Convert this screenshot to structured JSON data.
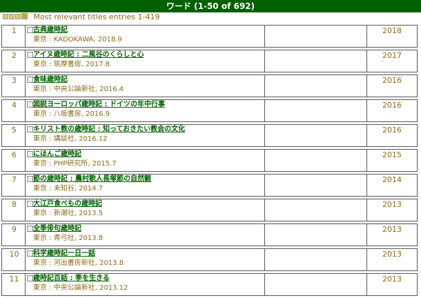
{
  "header": {
    "title": "ワード (1-50 of 692)"
  },
  "subheader": {
    "text": "Most relevant titles entries 1-419"
  },
  "entries": [
    {
      "num": "1",
      "title": "古典歳時記",
      "publisher": "東京 : KADOKAWA, 2018.9",
      "year": "2018"
    },
    {
      "num": "2",
      "title": "アイヌ歳時記 : 二風谷のくらしと心",
      "publisher": "東京 : 筑摩書房, 2017.8",
      "year": "2017"
    },
    {
      "num": "3",
      "title": "食味歳時記",
      "publisher": "東京 : 中央公論新社, 2016.4",
      "year": "2016"
    },
    {
      "num": "4",
      "title": "図説ヨーロッパ歳時記 : ドイツの年中行事",
      "publisher": "東京 : 八坂書房, 2016.9",
      "year": "2016"
    },
    {
      "num": "5",
      "title": "キリスト教の歳時記 : 知っておきたい教会の文化",
      "publisher": "東京 : 講談社, 2016.12",
      "year": "2016"
    },
    {
      "num": "6",
      "title": "にほんご歳時記",
      "publisher": "東京 : PHP研究所, 2015.7",
      "year": "2015"
    },
    {
      "num": "7",
      "title": "節の歳時記 : 農村歌人長塚節の自然観",
      "publisher": "東京 : 未知谷, 2014.7",
      "year": "2014"
    },
    {
      "num": "8",
      "title": "大江戸食べもの歳時記",
      "publisher": "東京 : 新潮社, 2013.5",
      "year": "2013"
    },
    {
      "num": "9",
      "title": "全季俳句歳時記",
      "publisher": "東京 : 青弓社, 2013.8",
      "year": "2013"
    },
    {
      "num": "10",
      "title": "科学歳時記一日一話",
      "publisher": "東京 : 河出書房新社, 2013.8",
      "year": "2013"
    },
    {
      "num": "11",
      "title": "歳時記百話 : 季を生きる",
      "publisher": "東京 : 中央公論新社, 2013.12",
      "year": "2013"
    }
  ]
}
